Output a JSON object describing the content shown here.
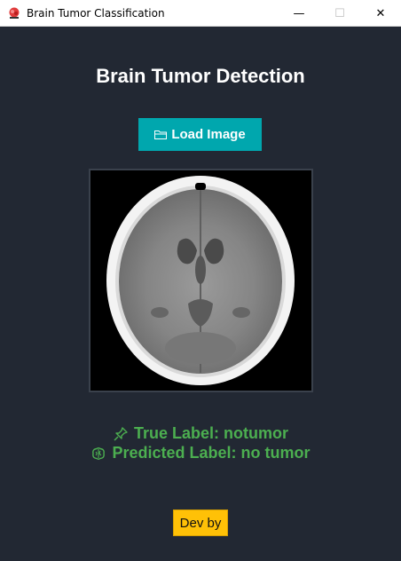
{
  "window": {
    "title": "Brain Tumor Classification",
    "minimize_glyph": "—",
    "maximize_glyph": "☐",
    "close_glyph": "✕"
  },
  "main": {
    "heading": "Brain Tumor Detection",
    "load_button_label": "Load Image",
    "image": {
      "description_icon": "brain-ct-scan"
    },
    "true_label_text": "True Label: notumor",
    "predicted_label_text": "Predicted Label: no tumor",
    "dev_button_label": "Dev by"
  },
  "colors": {
    "background": "#222833",
    "accent_button": "#00a7ae",
    "label_green": "#4caf50",
    "dev_button": "#ffc107"
  },
  "icons": {
    "app": "brain-app-icon",
    "load": "folder-icon",
    "true_label": "pushpin-icon",
    "predicted_label": "brain-icon"
  }
}
